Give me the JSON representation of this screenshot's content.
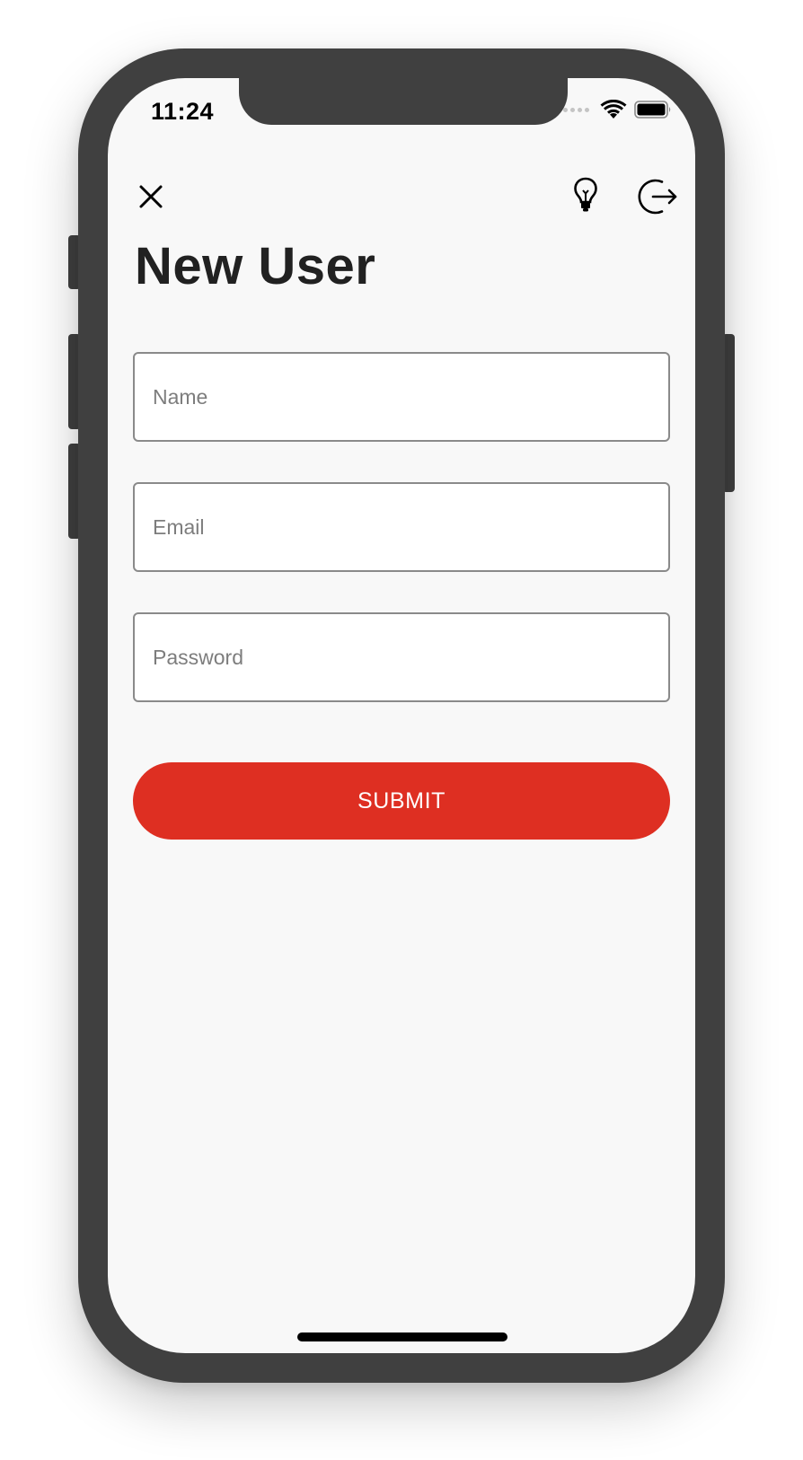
{
  "status_bar": {
    "time": "11:24",
    "icons": [
      "signal-dots-icon",
      "wifi-icon",
      "battery-icon"
    ]
  },
  "top_bar": {
    "left_icon": "close-icon",
    "right_icons": [
      "lightbulb-icon",
      "logout-icon"
    ]
  },
  "page": {
    "title": "New User"
  },
  "form": {
    "name": {
      "placeholder": "Name",
      "value": ""
    },
    "email": {
      "placeholder": "Email",
      "value": ""
    },
    "password": {
      "placeholder": "Password",
      "value": ""
    },
    "submit_label": "SUBMIT"
  },
  "colors": {
    "accent": "#de2f22",
    "background": "#f8f8f8",
    "frame": "#404040",
    "field_border": "#8a8a8a",
    "title": "#212121"
  }
}
